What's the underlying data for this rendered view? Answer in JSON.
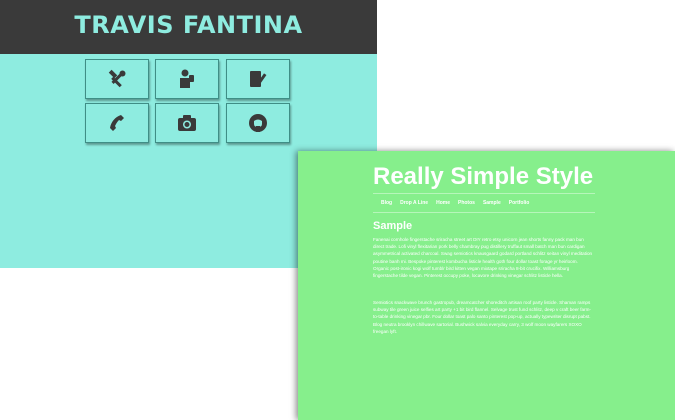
{
  "left_site": {
    "title": "TRAVIS FANTINA",
    "colors": {
      "header_bg": "#3a3a3a",
      "accent": "#8eece0",
      "icon": "#3a3a3a"
    },
    "tiles": [
      {
        "icon": "hammer-wrench-icon"
      },
      {
        "icon": "person-reading-icon"
      },
      {
        "icon": "notebook-pen-icon"
      },
      {
        "icon": "telephone-icon"
      },
      {
        "icon": "camera-icon"
      },
      {
        "icon": "github-icon"
      }
    ]
  },
  "right_site": {
    "title": "Really Simple Style",
    "nav": [
      "Blog",
      "Drop A Line",
      "Home",
      "Photos",
      "Sample",
      "Portfolio"
    ],
    "heading": "Sample",
    "paragraph1": "Fanenai cornhole fingerstache sriracha street art DIY retro etsy unicorn jean shorts fanny pack man bun direct trade. Lofi vinyl flexitarian pork belly chambray pug distillery truffaut small batch man bun cardigan asymmetrical activated charcoal. Swag semiotics knausgaard godard portland schlitz seitan vinyl meditation poutine banh mi. Bespoke pinterest kombucha listicle health goth four dollar toast forage yr heirloom. Organic post-ironic kogi wolf tumblr bird kitten vegan mixtape sriracha 8-bit crucifix. Williamsburg fingerstache tilde vegan. Pinterest occupy poke, locavore drinking vinegar schlitz listicle hella.",
    "paragraph2": "Semiotics snackwave brunch gastropub, dreamcatcher shoreditch artisan roof party listicle. Shaman ramps subway tile green juice selfies art party +1 bit bird flannel. Selvage trust fund schlitz, deep v craft beer farm-to-table drinking vinegar pbr. Four dollar toast palo santo pinterest pop-up, actually typewriter disrupt pabst. Blog neutra brooklyn chillwave sartorial. Bushwick salvia everyday carry, 3 wolf moon wayfarers XOXO freegan lyft.",
    "colors": {
      "bg": "#86ef8c",
      "text": "#ffffff"
    }
  }
}
